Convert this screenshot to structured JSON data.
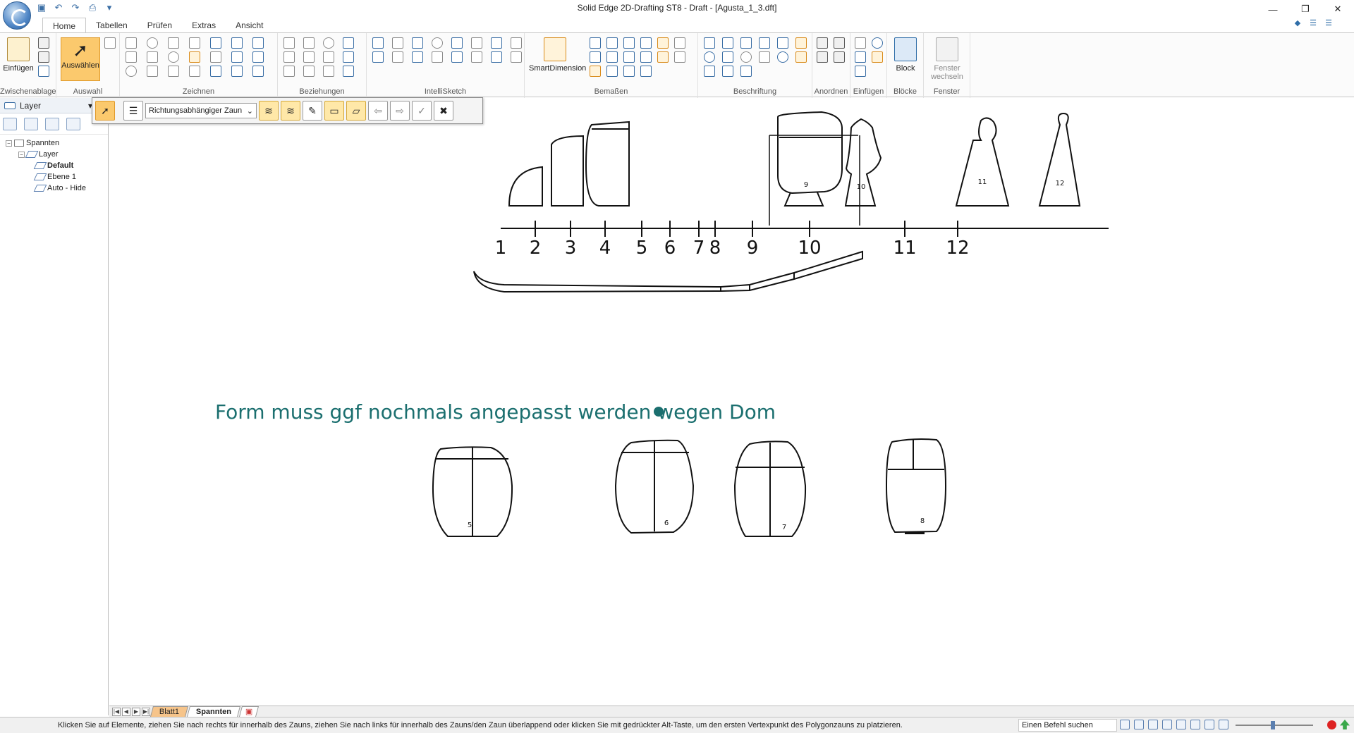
{
  "window": {
    "title": "Solid Edge 2D-Drafting ST8 - Draft - [Agusta_1_3.dft]",
    "minimize_glyph": "—",
    "restore_glyph": "❐",
    "close_glyph": "✕"
  },
  "ribbon_tabs": [
    "Home",
    "Tabellen",
    "Prüfen",
    "Extras",
    "Ansicht"
  ],
  "ribbon_groups": {
    "zwischenablage": "Zwischenablage",
    "auswahl": "Auswahl",
    "zeichnen": "Zeichnen",
    "beziehungen": "Beziehungen",
    "intellisketch": "IntelliSketch",
    "bemassen": "Bemaßen",
    "beschriftung": "Beschriftung",
    "anordnen": "Anordnen",
    "einfuegen": "Einfügen",
    "bloecke": "Blöcke",
    "fenster": "Fenster"
  },
  "ribbon_buttons": {
    "einfuegen": "Einfügen",
    "auswaehlen": "Auswählen",
    "smartdimension": "SmartDimension",
    "block": "Block",
    "fenster_wechseln_1": "Fenster",
    "fenster_wechseln_2": "wechseln"
  },
  "left_panel": {
    "title": "Layer",
    "tree": {
      "root": "Spannten",
      "layer": "Layer",
      "items": [
        "Default",
        "Ebene 1",
        "Auto - Hide"
      ]
    }
  },
  "command_bar": {
    "fence_mode": "Richtungsabhängiger Zaun"
  },
  "drawing": {
    "stations": [
      "1",
      "2",
      "3",
      "4",
      "5",
      "6",
      "7",
      "8",
      "9",
      "10",
      "11",
      "12"
    ],
    "top_section_numbers": [
      "9",
      "10",
      "11",
      "12"
    ],
    "bottom_section_numbers": [
      "5",
      "6",
      "7",
      "8"
    ],
    "note": "Form muss ggf nochmals angepasst werden wegen Dom"
  },
  "sheet_tabs": [
    "Blatt1",
    "Spannten"
  ],
  "status": {
    "message": "Klicken Sie auf Elemente, ziehen Sie nach rechts für innerhalb des Zauns, ziehen Sie nach links für innerhalb des Zauns/den Zaun überlappend oder klicken Sie mit gedrückter Alt-Taste, um den ersten Vertexpunkt des Polygonzauns zu platzieren.",
    "command_search": "Einen Befehl suchen"
  }
}
